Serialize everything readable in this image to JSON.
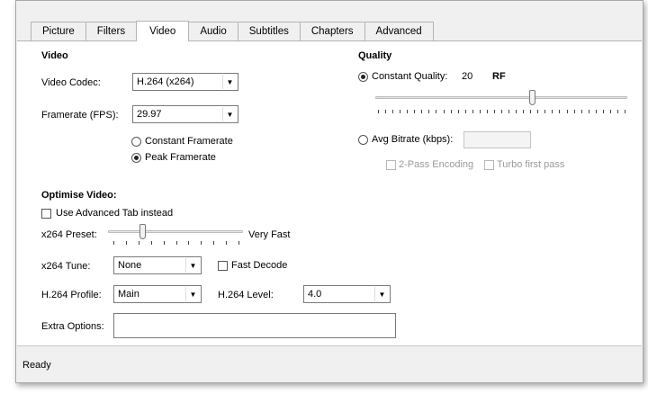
{
  "tabs": [
    "Picture",
    "Filters",
    "Video",
    "Audio",
    "Subtitles",
    "Chapters",
    "Advanced"
  ],
  "active_tab": "Video",
  "video": {
    "heading": "Video",
    "codec_label": "Video Codec:",
    "codec_value": "H.264 (x264)",
    "framerate_label": "Framerate (FPS):",
    "framerate_value": "29.97",
    "constant_framerate": "Constant Framerate",
    "peak_framerate": "Peak Framerate",
    "selected_framerate_mode": "Peak Framerate"
  },
  "quality": {
    "heading": "Quality",
    "constant_quality_label": "Constant Quality:",
    "constant_quality_value": "20",
    "rf_label": "RF",
    "slider_fraction": 0.62,
    "avg_bitrate_label": "Avg Bitrate (kbps):",
    "avg_bitrate_value": "",
    "two_pass": "2-Pass Encoding",
    "turbo_first_pass": "Turbo first pass",
    "selected_mode": "Constant Quality"
  },
  "optimise": {
    "heading": "Optimise Video:",
    "use_advanced_tab": "Use Advanced Tab instead",
    "preset_label": "x264 Preset:",
    "preset_value": "Very Fast",
    "preset_slider_fraction": 0.25,
    "tune_label": "x264 Tune:",
    "tune_value": "None",
    "fast_decode": "Fast Decode",
    "profile_label": "H.264 Profile:",
    "profile_value": "Main",
    "level_label": "H.264 Level:",
    "level_value": "4.0",
    "extra_options_label": "Extra Options:",
    "extra_options_value": ""
  },
  "status": {
    "text": "Ready"
  },
  "icons": {
    "dropdown": "chevron-down-icon"
  }
}
